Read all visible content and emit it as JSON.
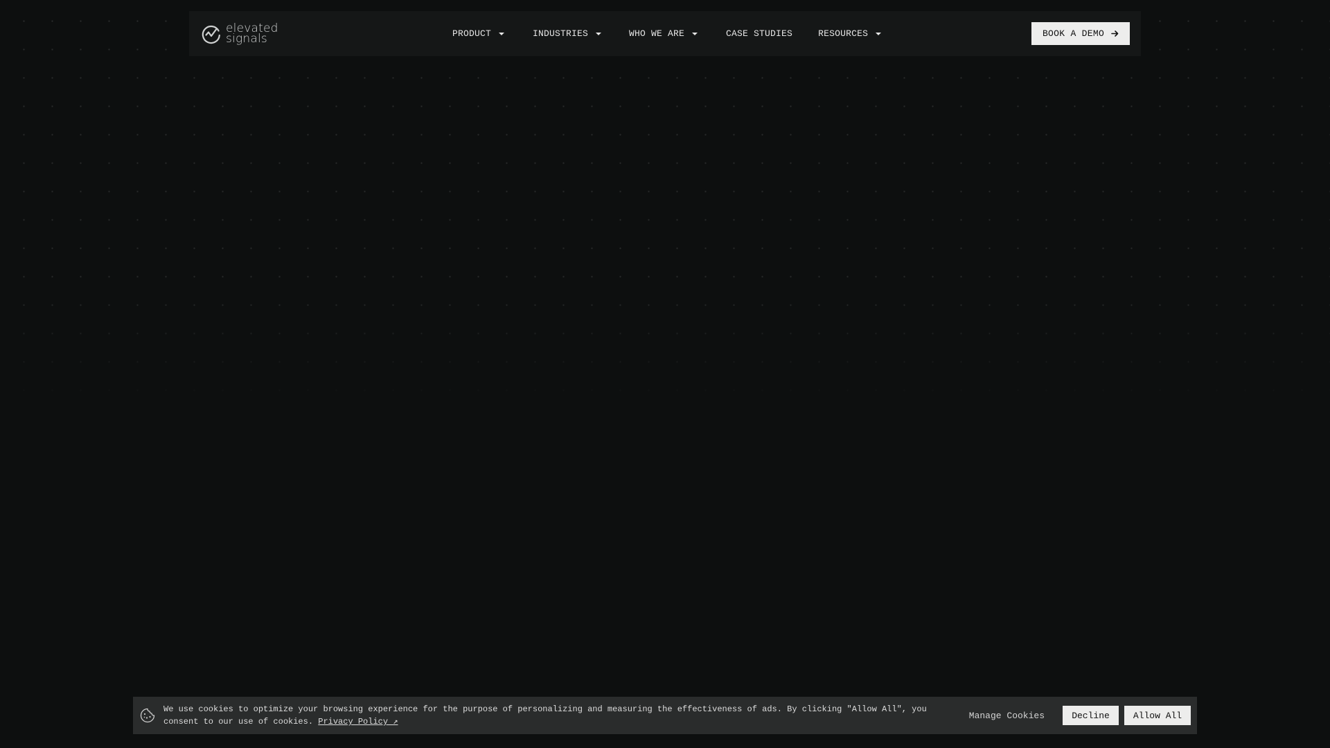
{
  "brand": {
    "line1": "elevated",
    "line2": "signals",
    "logo_icon": "signal-check-icon"
  },
  "nav": {
    "items": [
      {
        "label": "PRODUCT",
        "has_dropdown": true
      },
      {
        "label": "INDUSTRIES",
        "has_dropdown": true
      },
      {
        "label": "WHO WE ARE",
        "has_dropdown": true
      },
      {
        "label": "CASE STUDIES",
        "has_dropdown": false
      },
      {
        "label": "RESOURCES",
        "has_dropdown": true
      }
    ],
    "cta_label": "BOOK A DEMO",
    "cta_icon": "arrow-right-icon"
  },
  "cookie": {
    "icon": "cookie-icon",
    "message": "We use cookies to optimize your browsing experience for the purpose of personalizing and measuring the effectiveness of ads. By clicking \"Allow All\", you consent to our use of cookies.",
    "policy_link": "Privacy Policy ↗",
    "manage_label": "Manage Cookies",
    "decline_label": "Decline",
    "allow_label": "Allow All"
  },
  "colors": {
    "background": "#0d0f0f",
    "nav_bg": "#151717",
    "button_bg": "#ededec",
    "cookie_bg": "#2a2c2c"
  }
}
